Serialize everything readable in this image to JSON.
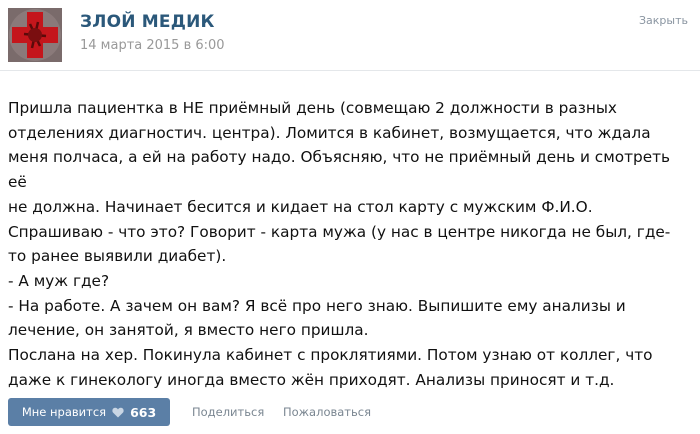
{
  "post": {
    "author": "ЗЛОЙ МЕДИК",
    "date": "14 марта 2015 в 6:00",
    "close_label": "Закрыть",
    "text": "Пришла пациентка в НЕ приёмный день (совмещаю 2 должности в разных\nотделениях диагностич. центра). Ломится в кабинет, возмущается, что ждала\nменя полчаса, а ей на работу надо. Объясняю, что не приёмный день и смотреть её\nне должна. Начинает бесится и кидает на стол карту с мужским Ф.И.О.\nСпрашиваю - что это? Говорит - карта мужа (у нас в центре никогда не был, где-\nто ранее выявили диабет).\n- А муж где?\n- На работе. А зачем он вам? Я всё про него знаю. Выпишите ему анализы и\nлечение, он занятой, я вместо него пришла.\nПослана на хер. Покинула кабинет с проклятиями. Потом узнаю от коллег, что\nдаже к гинекологу иногда вместо жён приходят. Анализы приносят и т.д."
  },
  "actions": {
    "like_label": "Мне нравится",
    "like_count": "663",
    "share_label": "Поделиться",
    "report_label": "Пожаловаться"
  },
  "icons": {
    "avatar": "red-cross-avatar",
    "like": "heart-icon"
  },
  "colors": {
    "author": "#2b587a",
    "like_button": "#5b7fa6",
    "avatar_cross": "#c4161c"
  }
}
